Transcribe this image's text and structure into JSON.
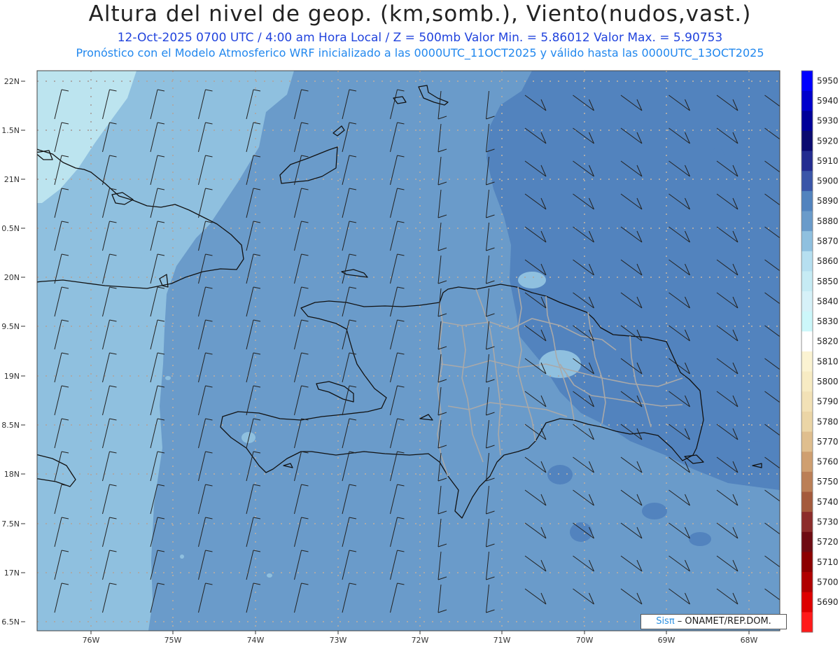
{
  "header": {
    "title": "Altura del nivel de geop. (km,somb.), Viento(nudos,vast.)",
    "line1": "12-Oct-2025   0700 UTC / 4:00 am Hora Local / Z = 500mb     Valor Min. = 5.86012  Valor Max. = 5.90753",
    "line2": "Pronóstico con el Modelo Atmosferico WRF inicializado a las 0000UTC_11OCT2025 y válido hasta las  0000UTC_13OCT2025"
  },
  "map": {
    "lat_labels": [
      "22N",
      "1.5N",
      "21N",
      "0.5N",
      "20N",
      "9.5N",
      "19N",
      "8.5N",
      "18N",
      "7.5N",
      "17N",
      "6.5N"
    ],
    "lon_labels": [
      "76W",
      "75W",
      "74W",
      "73W",
      "72W",
      "71W",
      "70W",
      "69W",
      "68W"
    ],
    "colors": {
      "light_cyan": "#bce4ef",
      "light_blue": "#8fc0df",
      "mid_blue": "#6a9bca",
      "dark_blue": "#5283be",
      "coast": "#111111",
      "borders": "#a9a9a9",
      "grid": "#aaaaaa",
      "barbs": "#222222"
    }
  },
  "colorbar": {
    "levels": [
      {
        "value": "5950",
        "color": "#0000ff"
      },
      {
        "value": "5940",
        "color": "#0000cc"
      },
      {
        "value": "5930",
        "color": "#000099"
      },
      {
        "value": "5920",
        "color": "#0a0a70"
      },
      {
        "value": "5910",
        "color": "#232c90"
      },
      {
        "value": "5900",
        "color": "#3a55a8"
      },
      {
        "value": "5890",
        "color": "#5283be"
      },
      {
        "value": "5880",
        "color": "#6a9bca"
      },
      {
        "value": "5870",
        "color": "#8fc0df"
      },
      {
        "value": "5860",
        "color": "#b6dff0"
      },
      {
        "value": "5850",
        "color": "#c6ebf4"
      },
      {
        "value": "5840",
        "color": "#d6f1f8"
      },
      {
        "value": "5830",
        "color": "#ccf7fa"
      },
      {
        "value": "5820",
        "color": "#ffffff"
      },
      {
        "value": "5810",
        "color": "#fbf3d2"
      },
      {
        "value": "5800",
        "color": "#f7ebc3"
      },
      {
        "value": "5790",
        "color": "#f2e1b6"
      },
      {
        "value": "5780",
        "color": "#ebd5a6"
      },
      {
        "value": "5770",
        "color": "#dfbe8e"
      },
      {
        "value": "5760",
        "color": "#cf9f70"
      },
      {
        "value": "5750",
        "color": "#bb7f56"
      },
      {
        "value": "5740",
        "color": "#a45a3c"
      },
      {
        "value": "5730",
        "color": "#8c2c2a"
      },
      {
        "value": "5720",
        "color": "#6e0b12"
      },
      {
        "value": "5710",
        "color": "#8c0000"
      },
      {
        "value": "5700",
        "color": "#b00000"
      },
      {
        "value": "5690",
        "color": "#dd0000"
      },
      {
        "value": "",
        "color": "#ff1a1a"
      }
    ]
  },
  "credit": {
    "sis": "Sisπ",
    "text": " – ONAMET/REP.DOM."
  }
}
